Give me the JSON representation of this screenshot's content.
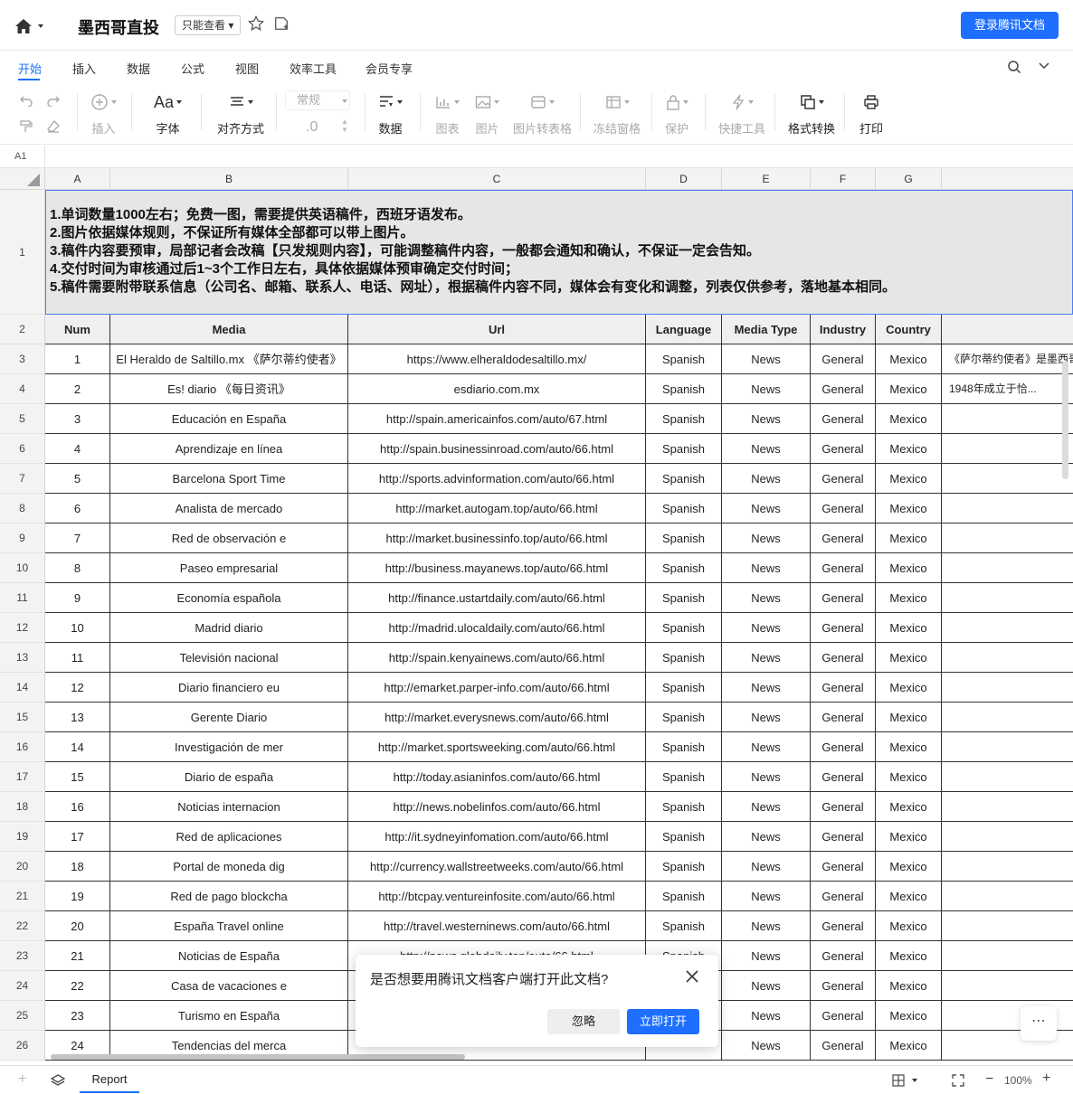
{
  "title_bar": {
    "doc_title": "墨西哥直投",
    "mode_badge": "只能查看",
    "login_button": "登录腾讯文档"
  },
  "menu_tabs": [
    "开始",
    "插入",
    "数据",
    "公式",
    "视图",
    "效率工具",
    "会员专享"
  ],
  "active_tab": "开始",
  "toolbar": {
    "insert": "插入",
    "font": "字体",
    "align": "对齐方式",
    "number_format": "常规",
    "decimal": ".0",
    "data": "数据",
    "chart": "图表",
    "image": "图片",
    "image_to_table": "图片转表格",
    "freeze": "冻结窗格",
    "protect": "保护",
    "shortcut": "快捷工具",
    "format_convert": "格式转换",
    "print": "打印"
  },
  "formula_bar": {
    "cell_ref": "A1"
  },
  "grid": {
    "columns": [
      "A",
      "B",
      "C",
      "D",
      "E",
      "F",
      "G"
    ],
    "notes": [
      "1.单词数量1000左右；免费一图，需要提供英语稿件，西班牙语发布。",
      "2.图片依据媒体规则，不保证所有媒体全部都可以带上图片。",
      "3.稿件内容要预审，局部记者会改稿【只发规则内容】，可能调整稿件内容，一般都会通知和确认，不保证一定会告知。",
      "4.交付时间为审核通过后1~3个工作日左右，具体依据媒体预审确定交付时间；",
      "5.稿件需要附带联系信息（公司名、邮箱、联系人、电话、网址），根据稿件内容不同，媒体会有变化和调整，列表仅供参考，落地基本相同。"
    ],
    "header": [
      "Num",
      "Media",
      "Url",
      "Language",
      "Media Type",
      "Industry",
      "Country",
      ""
    ],
    "rows": [
      [
        "1",
        "El Heraldo de Saltillo.mx 《萨尔蒂约使者》",
        "https://www.elheraldodesaltillo.mx/",
        "Spanish",
        "News",
        "General",
        "Mexico",
        "《萨尔蒂约使者》是墨西哥、..."
      ],
      [
        "2",
        "Es! diario 《每日资讯》",
        "esdiario.com.mx",
        "Spanish",
        "News",
        "General",
        "Mexico",
        "1948年成立于恰..."
      ],
      [
        "3",
        "Educación en España",
        "http://spain.americainfos.com/auto/67.html",
        "Spanish",
        "News",
        "General",
        "Mexico",
        ""
      ],
      [
        "4",
        "Aprendizaje en línea",
        "http://spain.businessinroad.com/auto/66.html",
        "Spanish",
        "News",
        "General",
        "Mexico",
        ""
      ],
      [
        "5",
        "Barcelona Sport Time",
        "http://sports.advinformation.com/auto/66.html",
        "Spanish",
        "News",
        "General",
        "Mexico",
        ""
      ],
      [
        "6",
        "Analista de mercado",
        "http://market.autogam.top/auto/66.html",
        "Spanish",
        "News",
        "General",
        "Mexico",
        ""
      ],
      [
        "7",
        "Red de observación e",
        "http://market.businessinfo.top/auto/66.html",
        "Spanish",
        "News",
        "General",
        "Mexico",
        ""
      ],
      [
        "8",
        "Paseo empresarial",
        "http://business.mayanews.top/auto/66.html",
        "Spanish",
        "News",
        "General",
        "Mexico",
        ""
      ],
      [
        "9",
        "Economía española",
        "http://finance.ustartdaily.com/auto/66.html",
        "Spanish",
        "News",
        "General",
        "Mexico",
        ""
      ],
      [
        "10",
        "Madrid diario",
        "http://madrid.ulocaldaily.com/auto/66.html",
        "Spanish",
        "News",
        "General",
        "Mexico",
        ""
      ],
      [
        "11",
        "Televisión nacional",
        "http://spain.kenyainews.com/auto/66.html",
        "Spanish",
        "News",
        "General",
        "Mexico",
        ""
      ],
      [
        "12",
        "Diario financiero eu",
        "http://emarket.parper-info.com/auto/66.html",
        "Spanish",
        "News",
        "General",
        "Mexico",
        ""
      ],
      [
        "13",
        "Gerente Diario",
        "http://market.everysnews.com/auto/66.html",
        "Spanish",
        "News",
        "General",
        "Mexico",
        ""
      ],
      [
        "14",
        "Investigación de mer",
        "http://market.sportsweeking.com/auto/66.html",
        "Spanish",
        "News",
        "General",
        "Mexico",
        ""
      ],
      [
        "15",
        "Diario de españa",
        "http://today.asianinfos.com/auto/66.html",
        "Spanish",
        "News",
        "General",
        "Mexico",
        ""
      ],
      [
        "16",
        "Noticias internacion",
        "http://news.nobelinfos.com/auto/66.html",
        "Spanish",
        "News",
        "General",
        "Mexico",
        ""
      ],
      [
        "17",
        "Red de aplicaciones",
        "http://it.sydneyinfomation.com/auto/66.html",
        "Spanish",
        "News",
        "General",
        "Mexico",
        ""
      ],
      [
        "18",
        "Portal de moneda dig",
        "http://currency.wallstreetweeks.com/auto/66.html",
        "Spanish",
        "News",
        "General",
        "Mexico",
        ""
      ],
      [
        "19",
        "Red de pago blockcha",
        "http://btcpay.ventureinfosite.com/auto/66.html",
        "Spanish",
        "News",
        "General",
        "Mexico",
        ""
      ],
      [
        "20",
        "España Travel online",
        "http://travel.westerninews.com/auto/66.html",
        "Spanish",
        "News",
        "General",
        "Mexico",
        ""
      ],
      [
        "21",
        "Noticias de España",
        "http://news.globdaily.top/auto/66.html",
        "Spanish",
        "News",
        "General",
        "Mexico",
        ""
      ],
      [
        "22",
        "Casa de vacaciones e",
        "",
        "",
        "News",
        "General",
        "Mexico",
        ""
      ],
      [
        "23",
        "Turismo en España",
        "",
        "",
        "News",
        "General",
        "Mexico",
        ""
      ],
      [
        "24",
        "Tendencias del merca",
        "",
        "",
        "News",
        "General",
        "Mexico",
        ""
      ]
    ]
  },
  "bottom_bar": {
    "sheet_tab": "Report",
    "zoom": "100%"
  },
  "dialog": {
    "message": "是否想要用腾讯文档客户端打开此文档?",
    "ignore": "忽略",
    "open": "立即打开"
  }
}
